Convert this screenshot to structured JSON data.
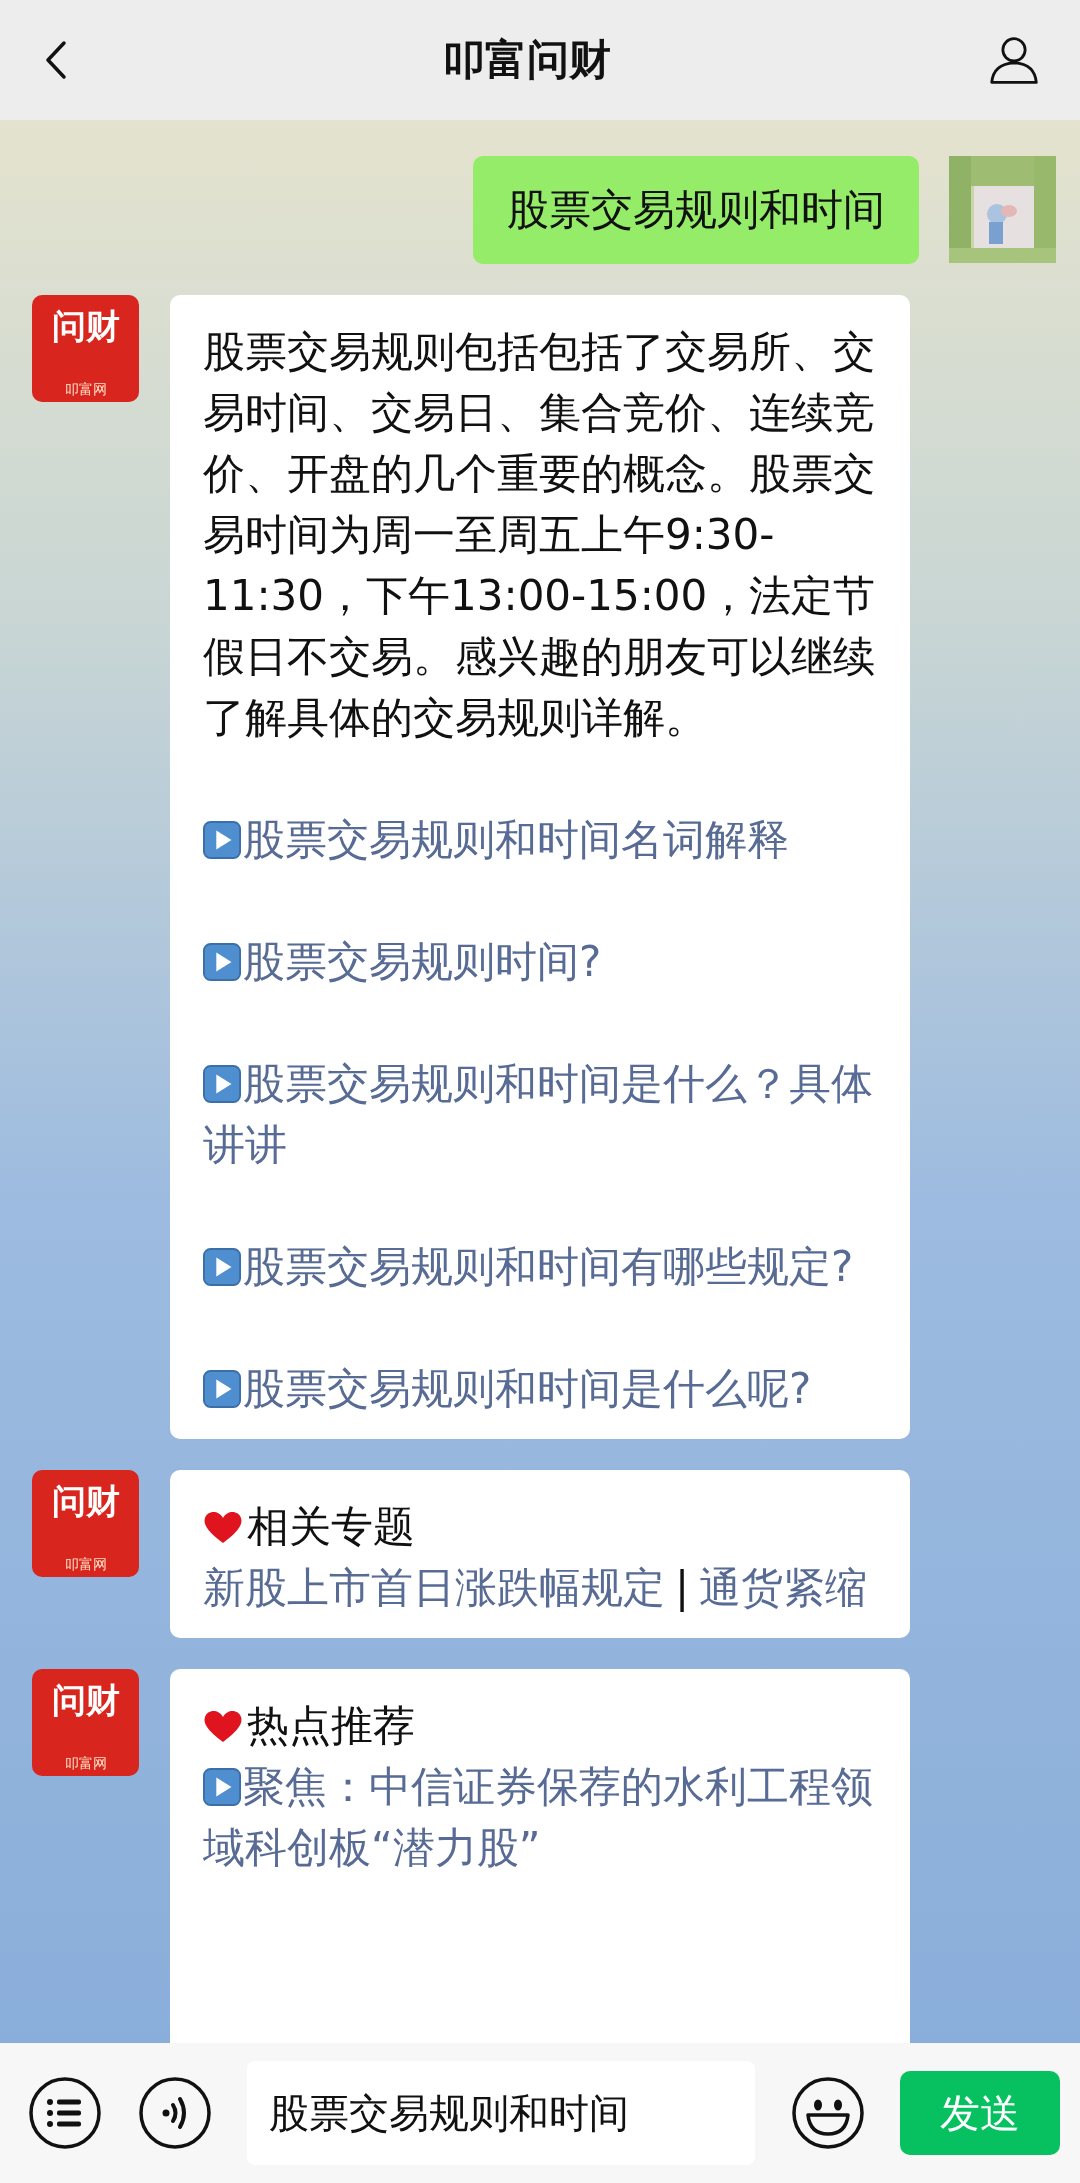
{
  "header": {
    "title": "叩富问财"
  },
  "messages": [
    {
      "kind": "user",
      "text": "股票交易规则和时间"
    },
    {
      "kind": "answer",
      "avatar": {
        "title": "问财",
        "subtitle": "叩富网"
      },
      "paragraph": "股票交易规则包括包括了交易所、交易时间、交易日、集合竞价、连续竞价、开盘的几个重要的概念。股票交易时间为周一至周五上午9:30-11:30，下午13:00-15:00，法定节假日不交易。感兴趣的朋友可以继续了解具体的交易规则详解。",
      "links": [
        "股票交易规则和时间名词解释",
        "股票交易规则时间?",
        "股票交易规则和时间是什么？具体讲讲",
        "股票交易规则和时间有哪些规定?",
        "股票交易规则和时间是什么呢?"
      ]
    },
    {
      "kind": "topics",
      "avatar": {
        "title": "问财",
        "subtitle": "叩富网"
      },
      "title": "相关专题",
      "links": [
        "新股上市首日涨跌幅规定",
        "通货紧缩"
      ],
      "separator": "|"
    },
    {
      "kind": "hot",
      "avatar": {
        "title": "问财",
        "subtitle": "叩富网"
      },
      "title": "热点推荐",
      "links": [
        "聚焦：中信证券保荐的水利工程领域科创板“潜力股”"
      ]
    }
  ],
  "input_bar": {
    "value": "股票交易规则和时间",
    "send": "发送"
  }
}
